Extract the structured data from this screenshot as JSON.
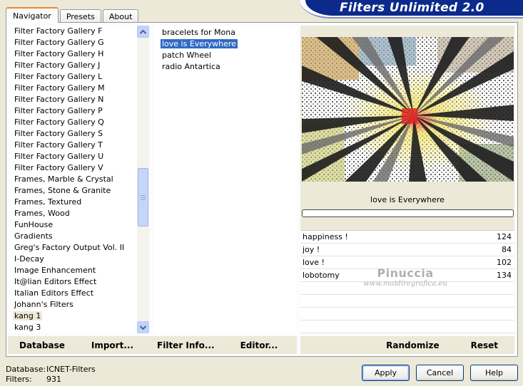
{
  "title": "Filters Unlimited 2.0",
  "tabs": [
    {
      "label": "Navigator",
      "active": true
    },
    {
      "label": "Presets",
      "active": false
    },
    {
      "label": "About",
      "active": false
    }
  ],
  "categories": [
    "Filter Factory Gallery F",
    "Filter Factory Gallery G",
    "Filter Factory Gallery H",
    "Filter Factory Gallery J",
    "Filter Factory Gallery L",
    "Filter Factory Gallery M",
    "Filter Factory Gallery N",
    "Filter Factory Gallery P",
    "Filter Factory Gallery Q",
    "Filter Factory Gallery S",
    "Filter Factory Gallery T",
    "Filter Factory Gallery U",
    "Filter Factory Gallery V",
    "Frames, Marble & Crystal",
    "Frames, Stone & Granite",
    "Frames, Textured",
    "Frames, Wood",
    "FunHouse",
    "Gradients",
    "Greg's Factory Output Vol. II",
    "I-Decay",
    "Image Enhancement",
    "It@lian Editors Effect",
    "Italian Editors Effect",
    "Johann's Filters",
    "kang 1",
    "kang 3"
  ],
  "selected_category": "kang 1",
  "filters": [
    "bracelets for Mona",
    "love is Everywhere",
    "patch Wheel",
    "radio Antartica"
  ],
  "selected_filter": "love is Everywhere",
  "filter_name": "love is Everywhere",
  "progress": 0,
  "params": [
    {
      "name": "happiness !",
      "value": "124"
    },
    {
      "name": "joy !",
      "value": "84"
    },
    {
      "name": "love !",
      "value": "102"
    },
    {
      "name": "lobotomy",
      "value": "134"
    }
  ],
  "toolbar": {
    "database": "Database",
    "import": "Import...",
    "filter_info": "Filter Info...",
    "editor": "Editor...",
    "randomize": "Randomize",
    "reset": "Reset"
  },
  "info": {
    "database_label": "Database:",
    "database_value": "ICNET-Filters",
    "filters_label": "Filters:",
    "filters_value": "931"
  },
  "buttons": {
    "apply": "Apply",
    "cancel": "Cancel",
    "help": "Help"
  },
  "watermark": {
    "line1": "Pinuccia",
    "line2": "www.maidiregrafica.eu"
  },
  "colors": {
    "banner": "#0b2a8c",
    "selection": "#316ac5",
    "tab_accent": "#e68b2c"
  }
}
